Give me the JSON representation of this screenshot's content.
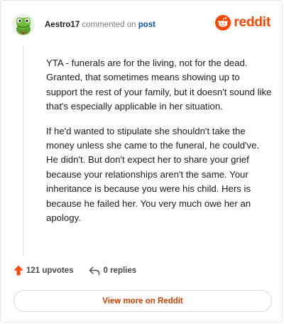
{
  "header": {
    "username": "Aestro17",
    "action_text": "commented on",
    "target_link": "post"
  },
  "brand": {
    "wordmark": "reddit",
    "color": "#ff4500",
    "icon": "reddit-snoo-icon"
  },
  "avatar": {
    "icon": "green-frog-avatar-icon"
  },
  "comment": {
    "paragraphs": [
      "YTA - funerals are for the living, not for the dead. Granted, that sometimes means showing up to support the rest of your family, but it doesn't sound like that's especially applicable in her situation.",
      "If he'd wanted to stipulate she shouldn't take the money unless she came to the funeral, he could've. He didn't. But don't expect her to share your grief because your relationships aren't the same. Your inheritance is because you were his child. Hers is because he failed her. You very much owe her an apology."
    ]
  },
  "footer": {
    "upvotes": "121 upvotes",
    "upvote_icon": "upvote-arrow-icon",
    "upvote_color": "#ff4500",
    "replies": "0 replies",
    "reply_icon": "reply-arrow-icon"
  },
  "cta": {
    "label": "View more on Reddit",
    "color": "#cc3f00"
  }
}
